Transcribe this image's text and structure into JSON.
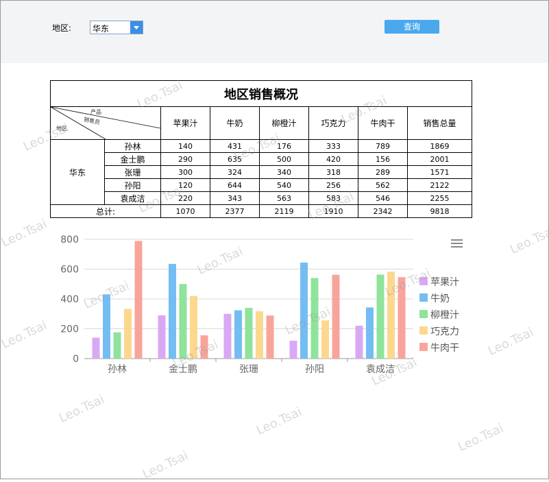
{
  "filter": {
    "region_label": "地区:",
    "region_value": "华东",
    "query_label": "查询"
  },
  "report": {
    "title": "地区销售概况",
    "corner": {
      "product": "产品",
      "salesperson": "销售员",
      "region": "地区"
    },
    "columns": [
      "苹果汁",
      "牛奶",
      "柳橙汁",
      "巧克力",
      "牛肉干",
      "销售总量"
    ],
    "region": "华东",
    "rows": [
      {
        "name": "孙林",
        "values": [
          "140",
          "431",
          "176",
          "333",
          "789",
          "1869"
        ]
      },
      {
        "name": "金士鹏",
        "values": [
          "290",
          "635",
          "500",
          "420",
          "156",
          "2001"
        ]
      },
      {
        "name": "张珊",
        "values": [
          "300",
          "324",
          "340",
          "318",
          "289",
          "1571"
        ]
      },
      {
        "name": "孙阳",
        "values": [
          "120",
          "644",
          "540",
          "256",
          "562",
          "2122"
        ]
      },
      {
        "name": "袁成洁",
        "values": [
          "220",
          "343",
          "563",
          "583",
          "546",
          "2255"
        ]
      }
    ],
    "total_label": "总计:",
    "totals": [
      "1070",
      "2377",
      "2119",
      "1910",
      "2342",
      "9818"
    ]
  },
  "chart_data": {
    "type": "bar",
    "categories": [
      "孙林",
      "金士鹏",
      "张珊",
      "孙阳",
      "袁成洁"
    ],
    "ylim": [
      0,
      800
    ],
    "yticks": [
      "0",
      "200",
      "400",
      "600",
      "800"
    ],
    "grid": true,
    "legend_position": "right",
    "series": [
      {
        "name": "苹果汁",
        "color": "#d9a8f5",
        "values": [
          140,
          290,
          300,
          120,
          220
        ]
      },
      {
        "name": "牛奶",
        "color": "#74bdf3",
        "values": [
          431,
          635,
          324,
          644,
          343
        ]
      },
      {
        "name": "柳橙汁",
        "color": "#8fe39c",
        "values": [
          176,
          500,
          340,
          540,
          563
        ]
      },
      {
        "name": "巧克力",
        "color": "#fcd88f",
        "values": [
          333,
          420,
          318,
          256,
          583
        ]
      },
      {
        "name": "牛肉干",
        "color": "#f9a49b",
        "values": [
          789,
          156,
          289,
          562,
          546
        ]
      }
    ]
  },
  "watermark": "Leo.Tsai"
}
